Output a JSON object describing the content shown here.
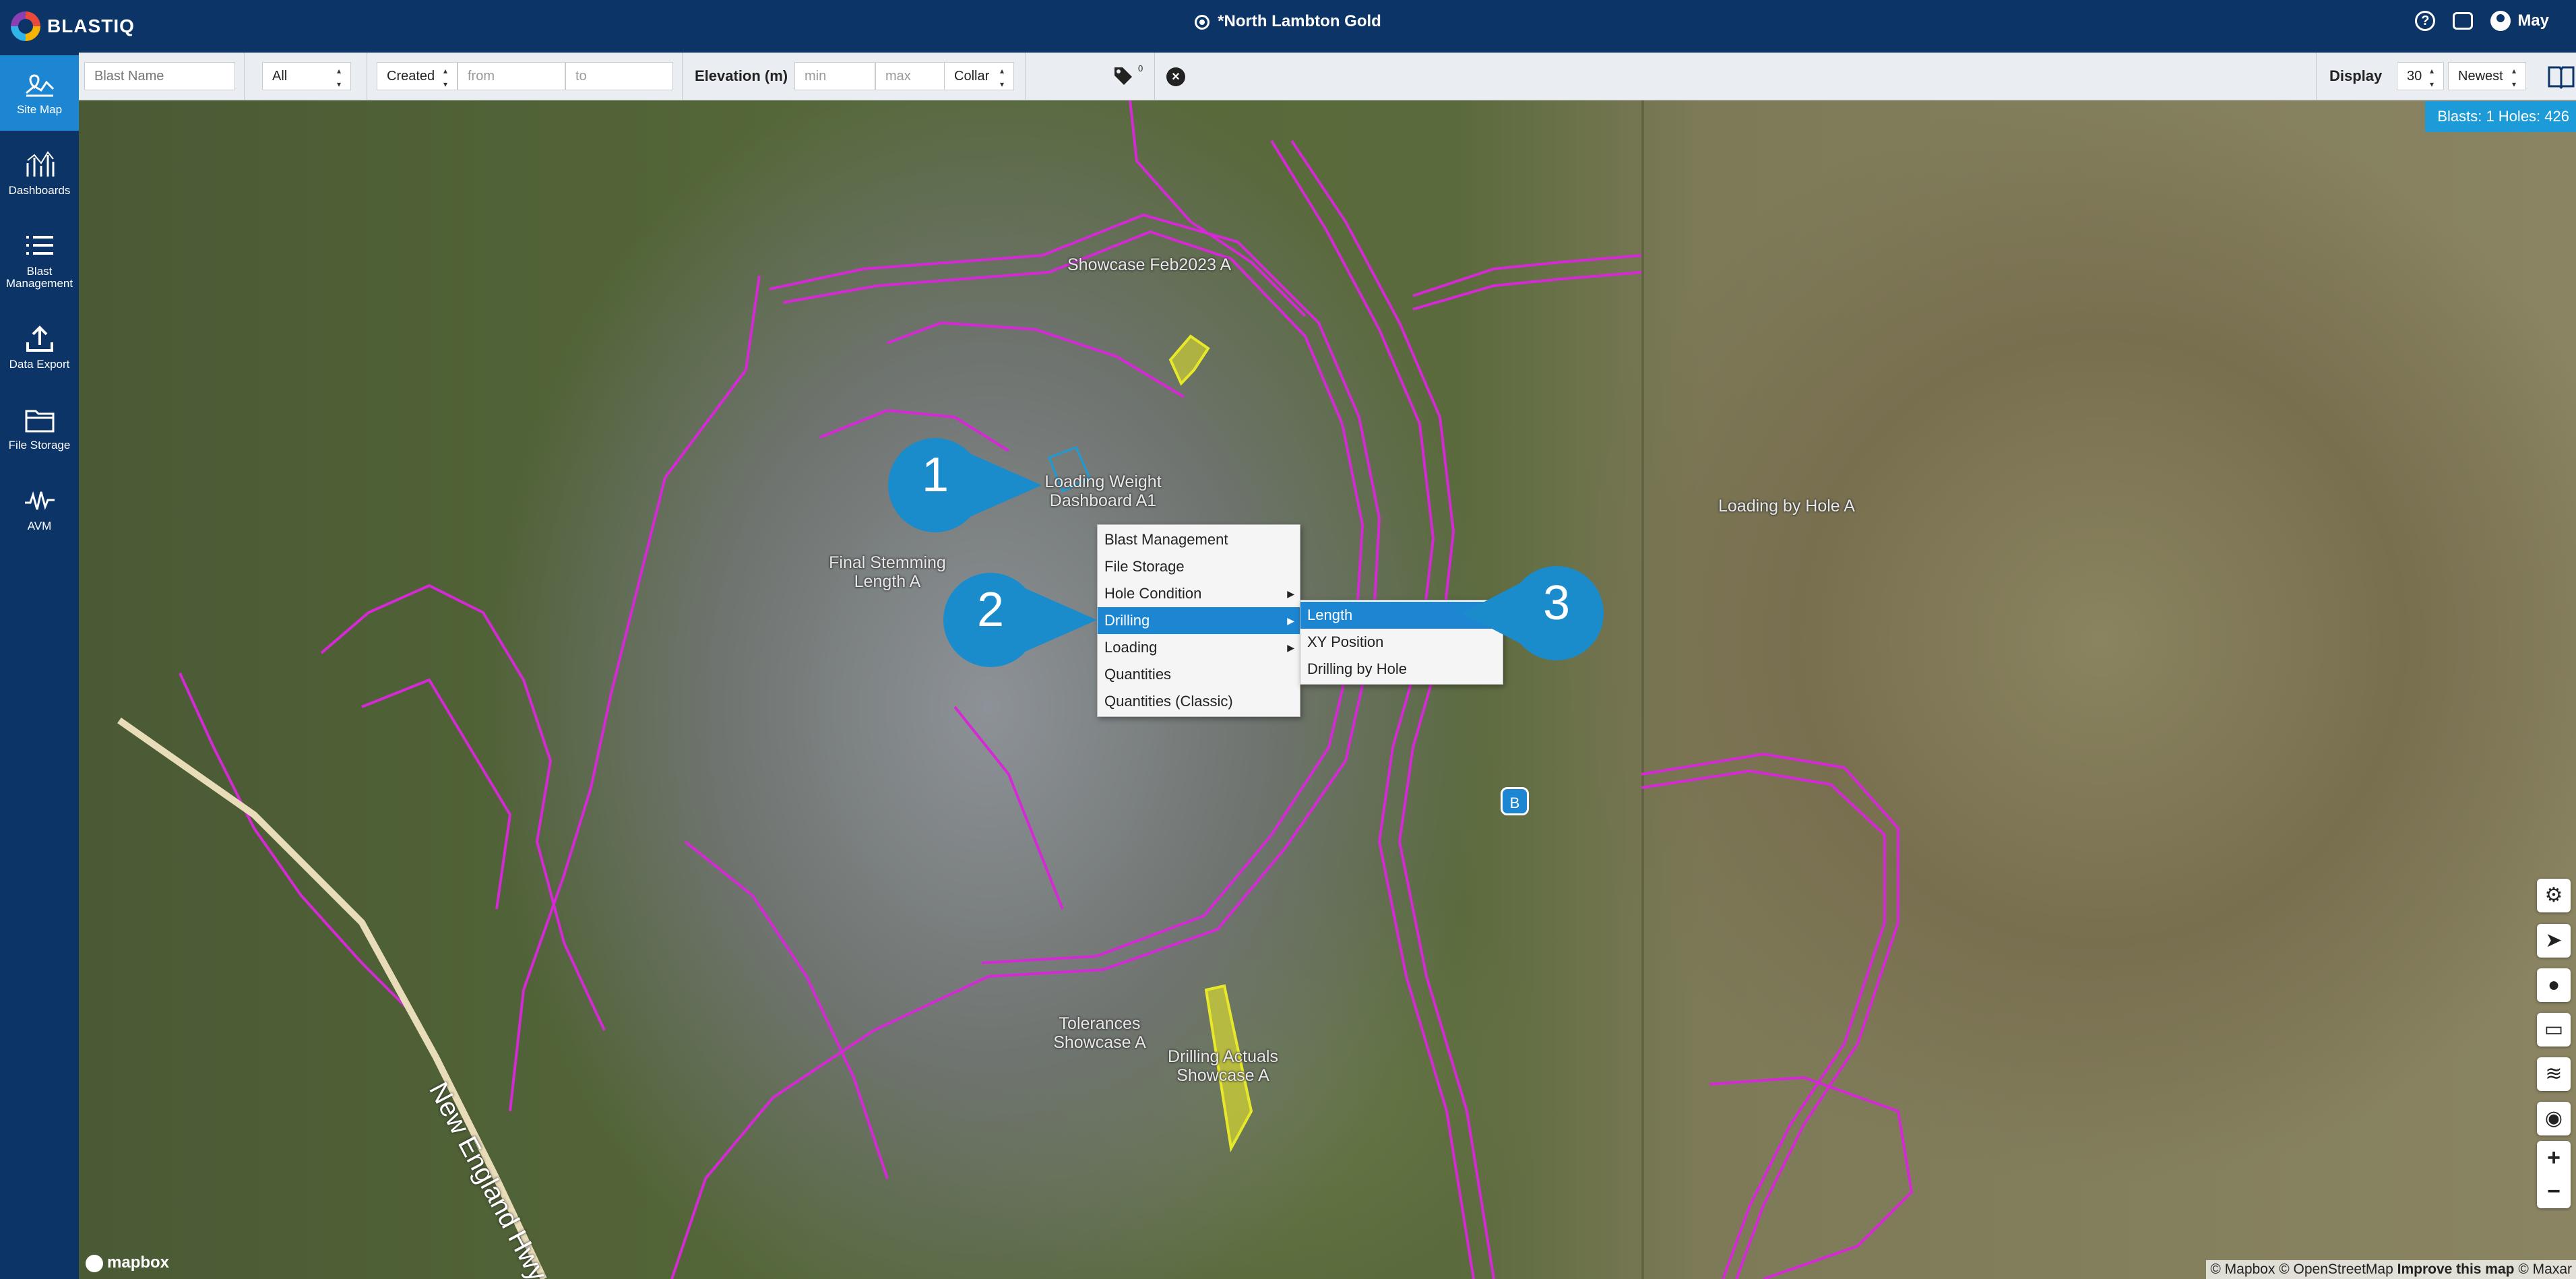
{
  "app": {
    "logo_text": "BLASTIQ",
    "site_title": "*North Lambton Gold",
    "user_name": "May"
  },
  "sidebar": {
    "items": [
      {
        "label": "Site Map",
        "icon": "site-map-icon",
        "active": true
      },
      {
        "label": "Dashboards",
        "icon": "dashboards-icon"
      },
      {
        "label": "Blast Management",
        "icon": "blast-management-icon"
      },
      {
        "label": "Data Export",
        "icon": "data-export-icon"
      },
      {
        "label": "File Storage",
        "icon": "file-storage-icon"
      },
      {
        "label": "AVM",
        "icon": "avm-icon"
      }
    ]
  },
  "filters": {
    "blast_name_placeholder": "Blast Name",
    "status_select": "All",
    "date_type_select": "Created",
    "date_from_placeholder": "from",
    "date_to_placeholder": "to",
    "elevation_label": "Elevation (m)",
    "elev_min_placeholder": "min",
    "elev_max_placeholder": "max",
    "elev_ref_select": "Collar",
    "tag_count": "0",
    "display_label": "Display",
    "display_count_select": "30",
    "sort_select": "Newest"
  },
  "map": {
    "counts_badge": "Blasts: 1 Holes: 426",
    "labels": [
      "Showcase Feb2023 A",
      "Loading Weight Dashboard A1",
      "Final Stemming Length A",
      "Loading by Hole A",
      "Tolerances Showcase A",
      "Drilling Actuals Showcase A"
    ],
    "road_label": "New England Hwy",
    "marker_label": "B",
    "attribution": "© Mapbox © OpenStreetMap",
    "improve_link": "Improve this map",
    "attribution_tail": "© Maxar",
    "mapbox_logo": "mapbox",
    "overlay_color": "#d629d6",
    "blast_polygon_color": "#e8e82a"
  },
  "context_menu": {
    "items": [
      {
        "label": "Blast Management"
      },
      {
        "label": "File Storage"
      },
      {
        "label": "Hole Condition",
        "submenu": true
      },
      {
        "label": "Drilling",
        "submenu": true,
        "selected": true
      },
      {
        "label": "Loading",
        "submenu": true
      },
      {
        "label": "Quantities"
      },
      {
        "label": "Quantities (Classic)"
      }
    ],
    "submenu_items": [
      {
        "label": "Length",
        "selected": true
      },
      {
        "label": "XY Position"
      },
      {
        "label": "Drilling by Hole"
      }
    ]
  },
  "callouts": [
    "1",
    "2",
    "3"
  ],
  "colors": {
    "header_bg": "#0c3466",
    "accent": "#1c86d3",
    "callout": "#1a8ccc"
  }
}
